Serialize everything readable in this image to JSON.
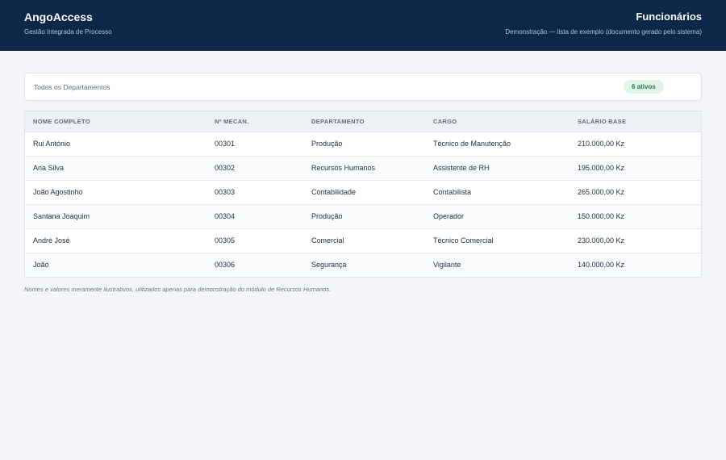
{
  "header": {
    "brand": "AngoAccess",
    "brand_subtitle": "Gestão Integrada de Processo",
    "page_title": "Funcionários",
    "page_subtitle": "Demonstração — lista de exemplo (documento gerado pelo sistema)"
  },
  "filter": {
    "department": "Todos os Departamentos",
    "count_badge": "6 ativos"
  },
  "table": {
    "columns": [
      "NOME COMPLETO",
      "Nº MECAN.",
      "DEPARTAMENTO",
      "CARGO",
      "SALÁRIO BASE"
    ],
    "rows": [
      [
        "Rui António",
        "00301",
        "Produção",
        "Técnico de Manutenção",
        "210.000,00 Kz"
      ],
      [
        "Ana Silva",
        "00302",
        "Recursos Humanos",
        "Assistente de RH",
        "195.000,00 Kz"
      ],
      [
        "João Agostinho",
        "00303",
        "Contabilidade",
        "Contabilista",
        "265.000,00 Kz"
      ],
      [
        "Santana Joaquim",
        "00304",
        "Produção",
        "Operador",
        "150.000,00 Kz"
      ],
      [
        "André José",
        "00305",
        "Comercial",
        "Técnico Comercial",
        "230.000,00 Kz"
      ],
      [
        "João",
        "00306",
        "Segurança",
        "Vigilante",
        "140.000,00 Kz"
      ]
    ]
  },
  "footnote": "Nomes e valores meramente ilustrativos, utilizados apenas para demonstração do módulo de Recursos Humanos.",
  "colors": {
    "header_bg": "#0d2748",
    "page_bg": "#f3f5f9",
    "badge_bg": "#e1f4e8",
    "badge_text": "#1f7a44"
  }
}
